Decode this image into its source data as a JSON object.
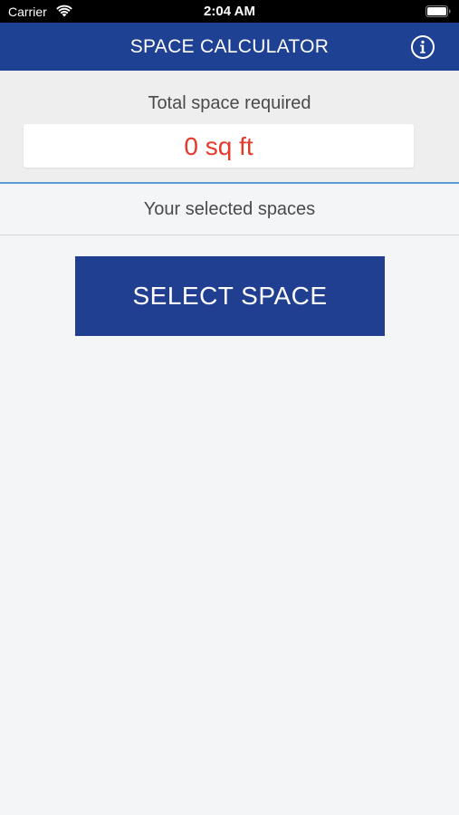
{
  "status_bar": {
    "carrier": "Carrier",
    "time": "2:04 AM"
  },
  "nav": {
    "title": "SPACE CALCULATOR",
    "info_icon": "info-circle-icon"
  },
  "total": {
    "label": "Total space required",
    "value": "0 sq ft"
  },
  "selected": {
    "label": "Your selected spaces"
  },
  "actions": {
    "select_space_label": "SELECT SPACE"
  },
  "colors": {
    "nav_background": "#1f4193",
    "button_background": "#213f90",
    "value_text": "#e53a2b",
    "divider": "#5b9bd5",
    "page_background": "#f4f5f7"
  }
}
